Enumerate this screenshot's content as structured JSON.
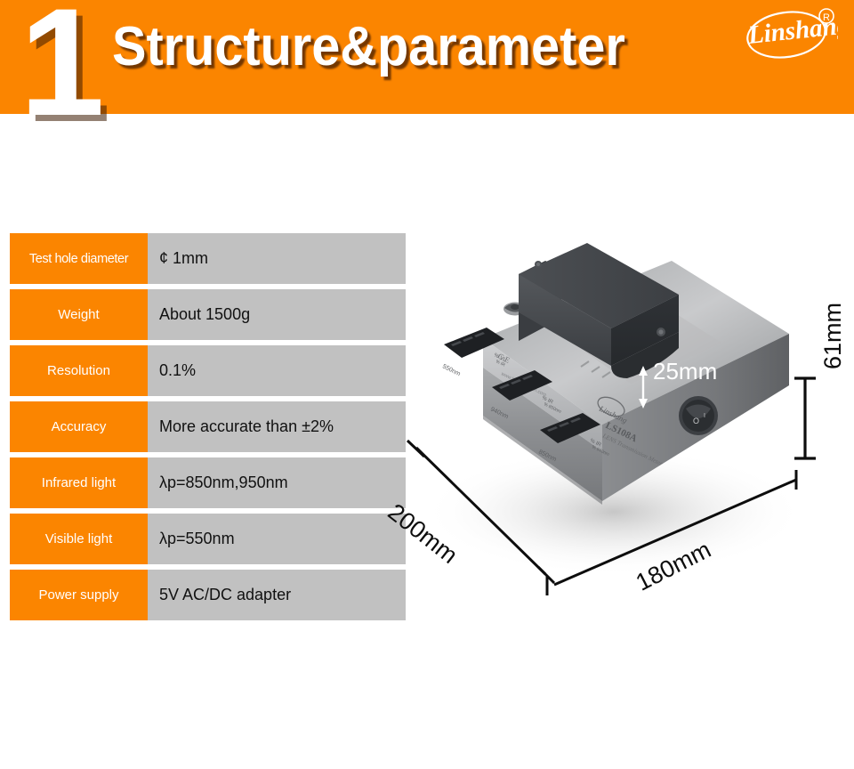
{
  "header": {
    "number": "1",
    "title": "Structure&parameter",
    "brand": "Linshang",
    "brand_mark": "®",
    "bar_color": "#fb8500",
    "title_color": "#ffffff"
  },
  "spec_table": {
    "label_color": "#fb8500",
    "value_color": "#c1c1c1",
    "rows": [
      {
        "label": "Test hole diameter",
        "value": "¢ 1mm"
      },
      {
        "label": "Weight",
        "value": "About 1500g"
      },
      {
        "label": "Resolution",
        "value": "0.1%"
      },
      {
        "label": "Accuracy",
        "value": "More accurate than ±2%"
      },
      {
        "label": "Infrared light",
        "value": "λp=850nm,950nm"
      },
      {
        "label": "Visible light",
        "value": "λp=550nm"
      },
      {
        "label": "Power supply",
        "value": "5V AC/DC adapter"
      }
    ]
  },
  "device": {
    "name": "LS108A",
    "subtitle": "LENS Transmission Meter",
    "brand": "Linshang",
    "displays": [
      {
        "wavelength": "550nm",
        "unit": "% VL",
        "reading": "8.8.8."
      },
      {
        "wavelength": "940nm",
        "unit": "% IR",
        "reading": "8.8.8."
      },
      {
        "wavelength": "850nm",
        "unit": "% IR",
        "reading": "8.8.8."
      }
    ],
    "dimensions": {
      "depth": "200mm",
      "width": "180mm",
      "height": "61mm",
      "gap": "25mm"
    }
  }
}
